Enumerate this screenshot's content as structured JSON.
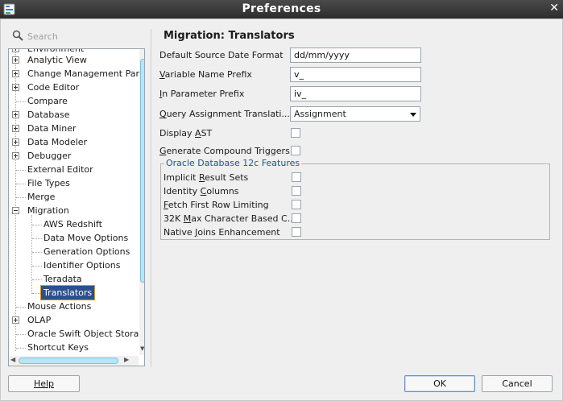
{
  "window": {
    "title": "Preferences",
    "close_glyph": "✕"
  },
  "search": {
    "placeholder": "Search"
  },
  "tree": {
    "items": [
      {
        "label": "Environment",
        "kind": "cut"
      },
      {
        "label": "Analytic View"
      },
      {
        "label": "Change Management Par"
      },
      {
        "label": "Code Editor"
      },
      {
        "label": "Compare"
      },
      {
        "label": "Database"
      },
      {
        "label": "Data Miner"
      },
      {
        "label": "Data Modeler"
      },
      {
        "label": "Debugger"
      },
      {
        "label": "External Editor"
      },
      {
        "label": "File Types"
      },
      {
        "label": "Merge"
      },
      {
        "label": "Migration"
      },
      {
        "label": "AWS Redshift"
      },
      {
        "label": "Data Move Options"
      },
      {
        "label": "Generation Options"
      },
      {
        "label": "Identifier Options"
      },
      {
        "label": "Teradata"
      },
      {
        "label": "Translators",
        "selected": true
      },
      {
        "label": "Mouse Actions"
      },
      {
        "label": "OLAP"
      },
      {
        "label": "Oracle Swift Object Stora"
      },
      {
        "label": "Shortcut Keys"
      }
    ]
  },
  "panel": {
    "title": "Migration: Translators",
    "default_date_format": {
      "label_pre": "Default Source Date Format",
      "value": "dd/mm/yyyy"
    },
    "variable_prefix": {
      "u": "V",
      "rest": "ariable Name Prefix",
      "value": "v_"
    },
    "in_param_prefix": {
      "u": "I",
      "rest": "n Parameter Prefix",
      "value": "iv_"
    },
    "query_assignment": {
      "u": "Q",
      "rest": "uery Assignment Translati...",
      "value": "Assignment"
    },
    "display_ast": {
      "pre": "Display ",
      "u": "A",
      "rest": "ST"
    },
    "compound_triggers": {
      "u": "G",
      "rest": "enerate Compound Triggers"
    },
    "group_title": "Oracle Database 12c Features",
    "features": [
      {
        "pre": "Implicit ",
        "u": "R",
        "rest": "esult Sets"
      },
      {
        "pre": "Identity ",
        "u": "C",
        "rest": "olumns"
      },
      {
        "pre": "",
        "u": "F",
        "rest": "etch First Row Limiting"
      },
      {
        "pre": "32K ",
        "u": "M",
        "rest": "ax Character Based C..."
      },
      {
        "pre": "Native ",
        "u": "J",
        "rest": "oins Enhancement"
      }
    ]
  },
  "buttons": {
    "help": "Help",
    "ok": "OK",
    "cancel": "Cancel"
  },
  "colors": {
    "titlebar": "#333333",
    "selection": "#2d4f8e",
    "scroll_thumb": "#b6e6f5",
    "group_title": "#25538a"
  }
}
